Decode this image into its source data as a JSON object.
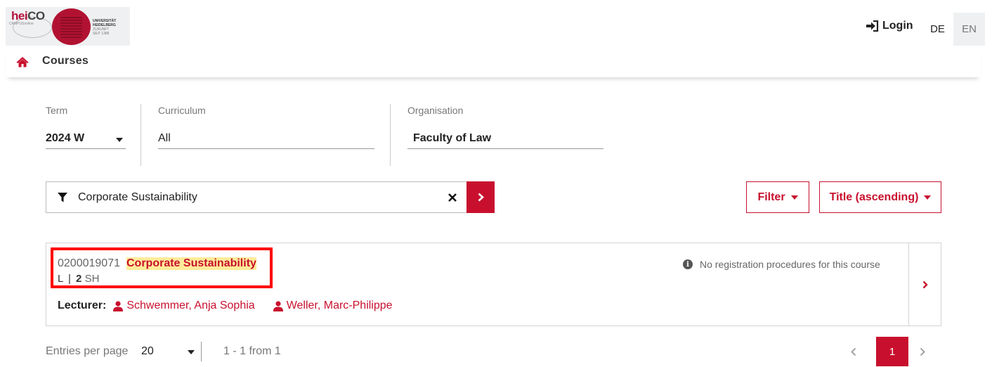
{
  "header": {
    "logo": {
      "heico": "hei",
      "co": "CO",
      "campus": "CAMPUSonline",
      "uni_line1": "UNIVERSITÄT",
      "uni_line2": "HEIDELBERG",
      "uni_line3": "ZUKUNFT",
      "uni_line4": "SEIT 1386"
    },
    "login_label": "Login",
    "lang_de": "DE",
    "lang_en": "EN"
  },
  "breadcrumb": {
    "label": "Courses"
  },
  "filters": {
    "term": {
      "label": "Term",
      "value": "2024 W"
    },
    "curriculum": {
      "label": "Curriculum",
      "value": "All"
    },
    "organisation": {
      "label": "Organisation",
      "value": "Faculty of Law"
    }
  },
  "search": {
    "value": "Corporate Sustainability",
    "clear_symbol": "✕"
  },
  "buttons": {
    "filter": "Filter",
    "sort": "Title (ascending)"
  },
  "course": {
    "number": "0200019071",
    "title": "Corporate Sustainability",
    "type": "L",
    "sep": "|",
    "hours": "2",
    "hours_unit": "SH",
    "registration_info": "No registration procedures for this course",
    "lecturer_label": "Lecturer:",
    "lecturers": [
      "Schwemmer, Anja Sophia",
      "Weller, Marc-Philippe"
    ]
  },
  "pagination": {
    "per_page_label": "Entries per page",
    "per_page_value": "20",
    "range": "1 - 1 from 1",
    "current_page": "1"
  },
  "colors": {
    "accent": "#c8102e",
    "highlight": "#ffeb99",
    "annotation": "#ff0000"
  }
}
